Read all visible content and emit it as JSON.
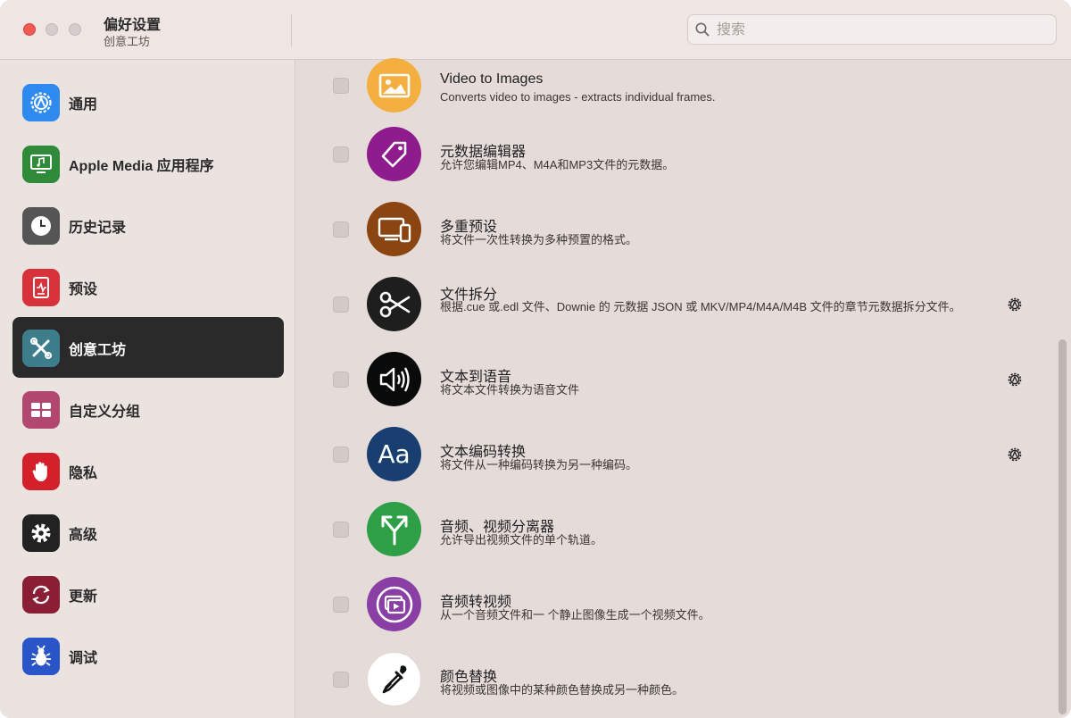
{
  "window": {
    "title": "偏好设置",
    "subtitle": "创意工坊"
  },
  "search": {
    "placeholder": "搜索",
    "value": ""
  },
  "sidebar": {
    "items": [
      {
        "label": "通用",
        "icon": "gear-badge-icon",
        "color": "#2f8af0"
      },
      {
        "label": "Apple Media 应用程序",
        "icon": "monitor-music-icon",
        "color": "#2f8a3a"
      },
      {
        "label": "历史记录",
        "icon": "clock-icon",
        "color": "#555555"
      },
      {
        "label": "预设",
        "icon": "preset-doc-icon",
        "color": "#d7323a"
      },
      {
        "label": "创意工坊",
        "icon": "tools-icon",
        "color": "#3d7d8c",
        "active": true
      },
      {
        "label": "自定义分组",
        "icon": "grid-blocks-icon",
        "color": "#b2486f"
      },
      {
        "label": "隐私",
        "icon": "hand-icon",
        "color": "#d4202a"
      },
      {
        "label": "高级",
        "icon": "cog-icon",
        "color": "#222222"
      },
      {
        "label": "更新",
        "icon": "refresh-icon",
        "color": "#8a1e34"
      },
      {
        "label": "调试",
        "icon": "bug-icon",
        "color": "#2a55c8"
      }
    ]
  },
  "features": [
    {
      "title": "Video to Images",
      "desc": "Converts video to images - extracts individual frames.",
      "icon": "image-icon",
      "color": "#f3b041",
      "has_settings": false
    },
    {
      "title": "元数据编辑器",
      "desc": "允许您编辑MP4、M4A和MP3文件的元数据。",
      "icon": "tag-icon",
      "color": "#8e1c8c",
      "has_settings": false
    },
    {
      "title": "多重预设",
      "desc": "将文件一次性转换为多种预置的格式。",
      "icon": "devices-icon",
      "color": "#8a4510",
      "has_settings": false
    },
    {
      "title": "文件拆分",
      "desc": "根据.cue 或.edl 文件、Downie 的 元数据 JSON 或 MKV/MP4/M4A/M4B 文件的章节元数据拆分文件。",
      "icon": "scissors-icon",
      "color": "#1e1e1e",
      "has_settings": true
    },
    {
      "title": "文本到语音",
      "desc": "将文本文件转换为语音文件",
      "icon": "speaker-icon",
      "color": "#0a0a0a",
      "has_settings": true
    },
    {
      "title": "文本编码转换",
      "desc": "将文件从一种编码转换为另一种编码。",
      "icon": "aa-icon",
      "icon_text": "Aa",
      "color": "#183f6f",
      "has_settings": true
    },
    {
      "title": "音频、视频分离器",
      "desc": "允许导出视频文件的单个轨道。",
      "icon": "split-arrow-icon",
      "color": "#2e9e47",
      "has_settings": false
    },
    {
      "title": "音频转视频",
      "desc": "从一个音频文件和一 个静止图像生成一个视频文件。",
      "icon": "play-stack-icon",
      "color": "#8a3fa4",
      "has_settings": false
    },
    {
      "title": "颜色替换",
      "desc": "将视频或图像中的某种颜色替换成另一种颜色。",
      "icon": "eyedropper-icon",
      "color": "#ffffff",
      "has_settings": false
    }
  ]
}
